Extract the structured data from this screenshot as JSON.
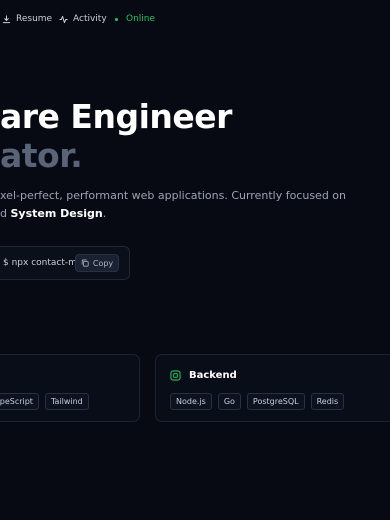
{
  "nav": {
    "resume_label": "Resume",
    "activity_label": "Activity",
    "status_label": "Online",
    "status_color": "#22c55e"
  },
  "hero": {
    "title_line1": "are Engineer",
    "title_line2": "ator.",
    "desc_line1": "xel-perfect, performant web applications. Currently focused on",
    "desc_line2_prefix": "d ",
    "desc_line2_highlight": "System Design",
    "desc_line2_suffix": "."
  },
  "command": {
    "text": "$ npx contact-me",
    "copy_label": "Copy"
  },
  "cards": {
    "left": {
      "tags": [
        "ypeScript",
        "Tailwind"
      ]
    },
    "right": {
      "title": "Backend",
      "icon": "chip-icon",
      "tags": [
        "Node.js",
        "Go",
        "PostgreSQL",
        "Redis"
      ]
    }
  },
  "colors": {
    "background": "#070a13",
    "accent_green": "#22c55e",
    "muted_title": "#5a6478"
  }
}
